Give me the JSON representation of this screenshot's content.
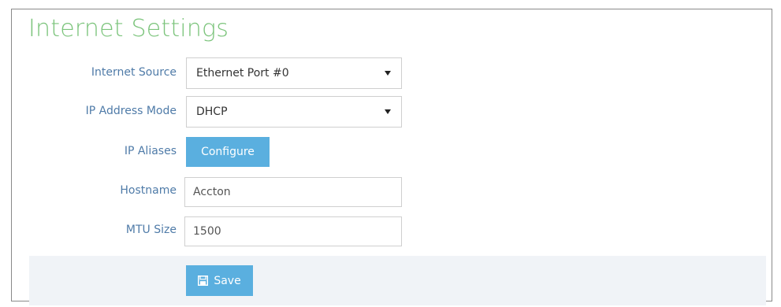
{
  "page": {
    "title": "Internet Settings"
  },
  "form": {
    "internet_source": {
      "label": "Internet Source",
      "value": "Ethernet Port #0"
    },
    "ip_address_mode": {
      "label": "IP Address Mode",
      "value": "DHCP"
    },
    "ip_aliases": {
      "label": "IP Aliases",
      "button_label": "Configure"
    },
    "hostname": {
      "label": "Hostname",
      "value": "Accton"
    },
    "mtu_size": {
      "label": "MTU Size",
      "value": "1500"
    }
  },
  "footer": {
    "save_label": "Save",
    "save_icon": "floppy-disk-icon"
  },
  "colors": {
    "title": "#7cc47c",
    "label": "#4f7ba8",
    "button": "#5aafdf",
    "footer_bg": "#f0f3f7"
  }
}
